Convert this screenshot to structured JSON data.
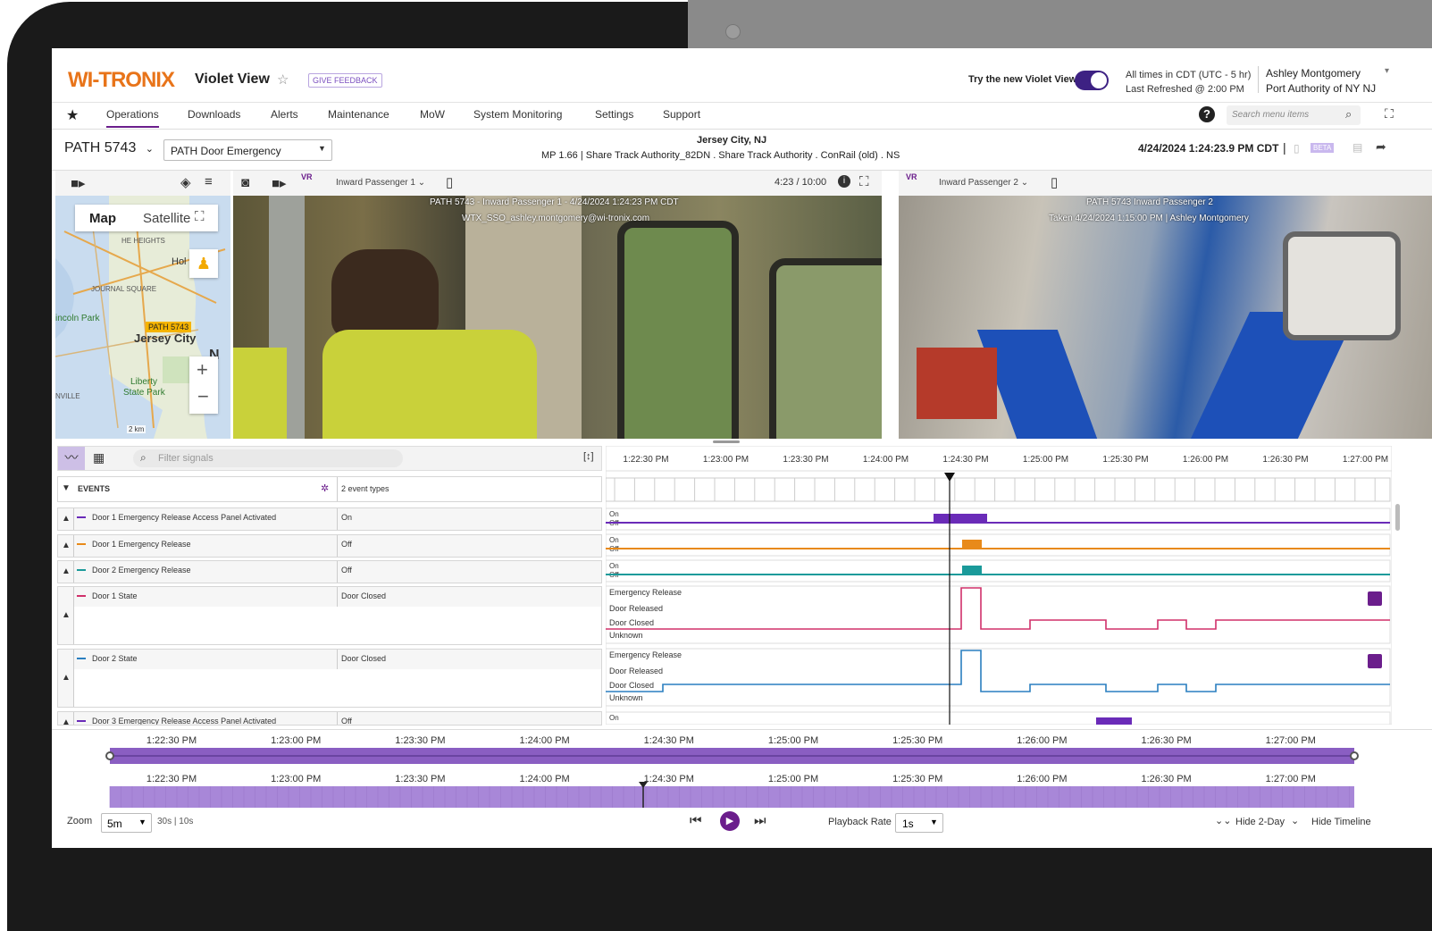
{
  "app": {
    "brand": "WI-TRONIX",
    "title": "Violet View",
    "feedback_label": "GIVE FEEDBACK",
    "try_new_label": "Try the new Violet View",
    "timezone_line": "All times in CDT (UTC - 5 hr)",
    "refreshed_line": "Last Refreshed @ 2:00 PM",
    "user_name": "Ashley Montgomery",
    "user_org": "Port Authority of NY NJ",
    "accent": "#6b1e8c"
  },
  "nav": {
    "items": [
      "Operations",
      "Downloads",
      "Alerts",
      "Maintenance",
      "MoW",
      "System Monitoring",
      "Settings",
      "Support"
    ],
    "active": "Operations",
    "search_placeholder": "Search menu items"
  },
  "context": {
    "vehicle": "PATH 5743",
    "event_select": "PATH Door Emergency",
    "location": "Jersey City, NJ",
    "track_info": "MP 1.66 | Share Track Authority_82DN . Share Track Authority . ConRail (old) . NS",
    "timestamp": "4/24/2024 1:24:23.9 PM CDT",
    "beta_label": "BETA"
  },
  "map": {
    "tab_map": "Map",
    "tab_satellite": "Satellite",
    "labels": [
      "HE HEIGHTS",
      "Hol",
      "JOURNAL SQUARE",
      "incoln Park",
      "Jersey City",
      "N",
      "Liberty",
      "State Park",
      "NVILLE"
    ],
    "marker": "PATH 5743",
    "scale": "2 km"
  },
  "video1": {
    "camera": "Inward Passenger 1",
    "vr": "VR",
    "position": "4:23 / 10:00",
    "overlay_line1": "PATH 5743 - Inward Passenger 1 - 4/24/2024 1:24:23 PM CDT",
    "overlay_line2": "WTX_SSO_ashley.montgomery@wi-tronix.com"
  },
  "video2": {
    "camera": "Inward Passenger 2",
    "vr": "VR",
    "overlay_line1": "PATH 5743 Inward Passenger 2",
    "overlay_line2": "Taken 4/24/2024 1:15:00 PM | Ashley Montgomery"
  },
  "signals": {
    "filter_placeholder": "Filter signals",
    "events_label": "EVENTS",
    "events_value": "2 event types",
    "rows": [
      {
        "name": "Door 1 Emergency Release Access Panel Activated",
        "value": "On",
        "color": "#6a2bb8"
      },
      {
        "name": "Door 1 Emergency Release",
        "value": "Off",
        "color": "#e88a1a"
      },
      {
        "name": "Door 2 Emergency Release",
        "value": "Off",
        "color": "#1a9a9a"
      },
      {
        "name": "Door 1 State",
        "value": "Door Closed",
        "color": "#d0306a"
      },
      {
        "name": "Door 2 State",
        "value": "Door Closed",
        "color": "#2a7fc0"
      },
      {
        "name": "Door 3 Emergency Release Access Panel Activated",
        "value": "Off",
        "color": "#6a2bb8"
      }
    ]
  },
  "graph": {
    "ticks": [
      "1:22:30 PM",
      "1:23:00 PM",
      "1:23:30 PM",
      "1:24:00 PM",
      "1:24:30 PM",
      "1:25:00 PM",
      "1:25:30 PM",
      "1:26:00 PM",
      "1:26:30 PM",
      "1:27:00 PM"
    ],
    "on_label": "On",
    "off_label": "Off",
    "state_labels": [
      "Emergency Release",
      "Door Released",
      "Door Closed",
      "Unknown"
    ]
  },
  "timeline": {
    "ticks": [
      "1:22:30 PM",
      "1:23:00 PM",
      "1:23:30 PM",
      "1:24:00 PM",
      "1:24:30 PM",
      "1:25:00 PM",
      "1:25:30 PM",
      "1:26:00 PM",
      "1:26:30 PM",
      "1:27:00 PM"
    ],
    "zoom_label": "Zoom",
    "zoom_value": "5m",
    "zoom_options": "30s | 10s",
    "playback_label": "Playback Rate",
    "playback_value": "1s",
    "hide_2day": "Hide 2-Day",
    "hide_timeline": "Hide Timeline"
  }
}
